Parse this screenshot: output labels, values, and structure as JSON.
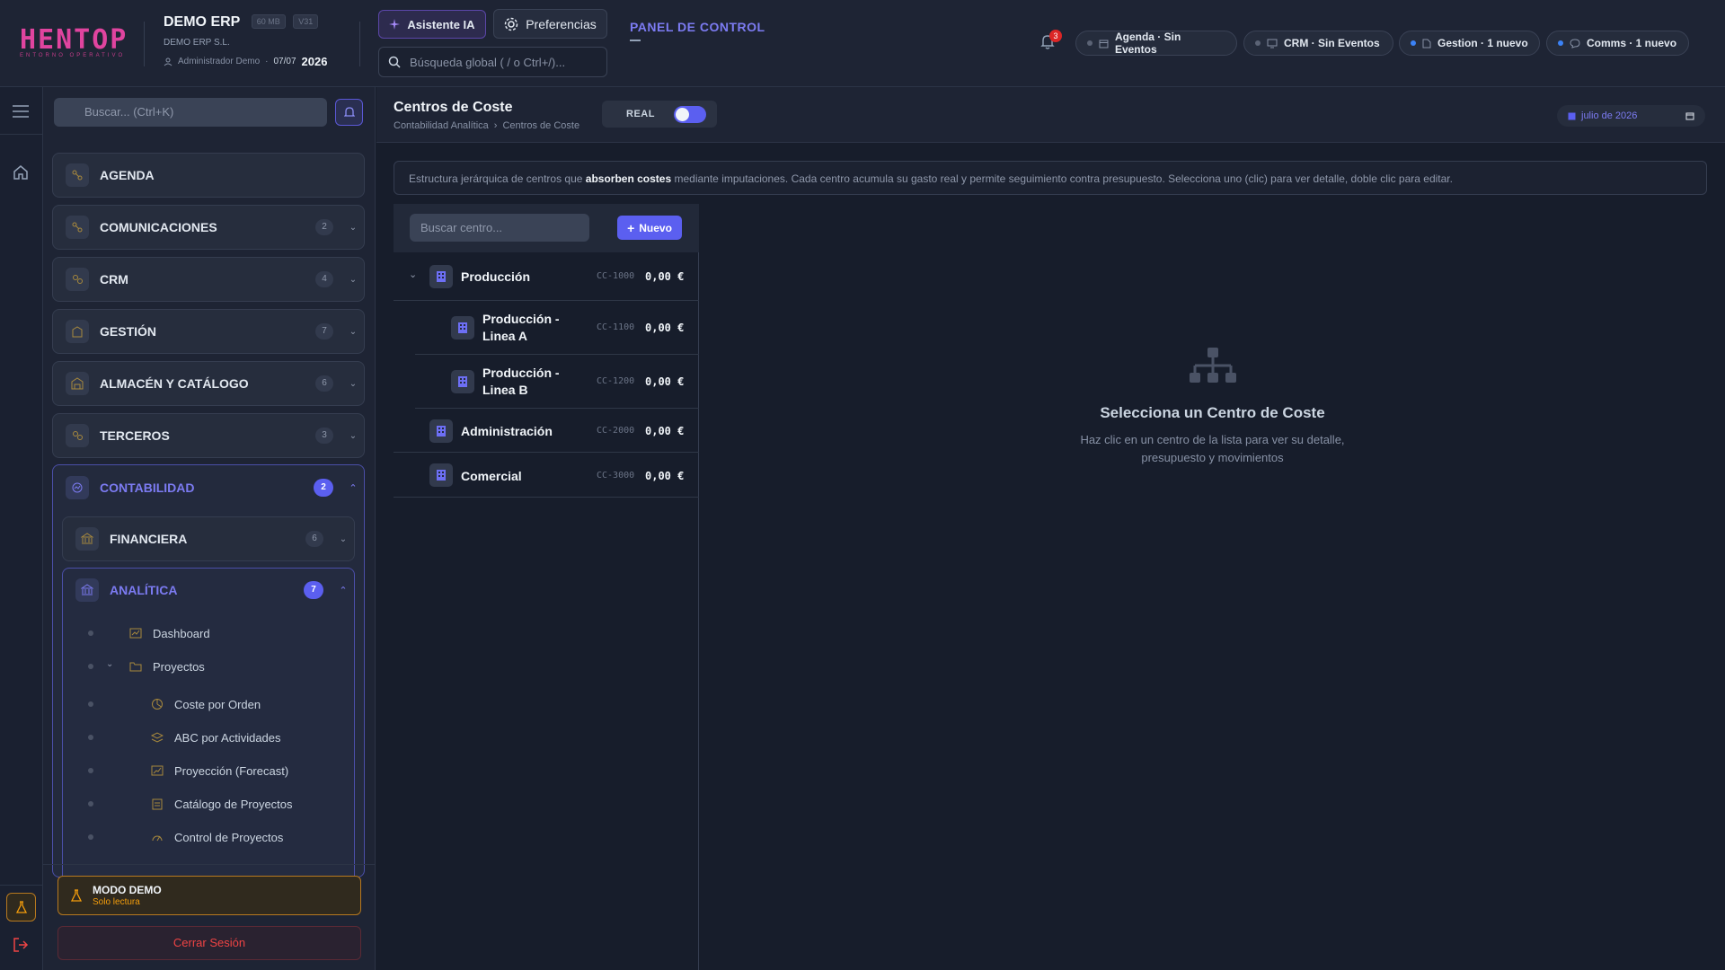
{
  "header": {
    "logo_text": "HENTOP",
    "logo_sub": "ENTORNO OPERATIVO",
    "company_name": "DEMO ERP",
    "badge_size": "60 MB",
    "badge_version": "V31",
    "company_sub": "DEMO ERP S.L.",
    "user": "Administrador Demo",
    "date": "07/07",
    "year": "2026",
    "ai_button": "Asistente IA",
    "prefs_button": "Preferencias",
    "search_placeholder": "Búsqueda global ( / o Ctrl+/)...",
    "panel_title": "PANEL DE CONTROL",
    "notif_count": "3",
    "chips": [
      {
        "label": "Agenda · Sin Eventos",
        "icon": "calendar-icon",
        "status": "inactive"
      },
      {
        "label": "CRM · Sin Eventos",
        "icon": "monitor-icon",
        "status": "inactive"
      },
      {
        "label": "Gestion · 1 nuevo",
        "icon": "document-icon",
        "status": "active"
      },
      {
        "label": "Comms · 1 nuevo",
        "icon": "chat-icon",
        "status": "active"
      }
    ]
  },
  "sidebar": {
    "search_placeholder": "Buscar... (Ctrl+K)",
    "items": [
      {
        "label": "AGENDA",
        "count": null
      },
      {
        "label": "COMUNICACIONES",
        "count": "2"
      },
      {
        "label": "CRM",
        "count": "4"
      },
      {
        "label": "GESTIÓN",
        "count": "7"
      },
      {
        "label": "ALMACÉN Y CATÁLOGO",
        "count": "6"
      },
      {
        "label": "TERCEROS",
        "count": "3"
      }
    ],
    "open_group": {
      "label": "CONTABILIDAD",
      "count": "2"
    },
    "financiera": {
      "label": "FINANCIERA",
      "count": "6"
    },
    "analitica": {
      "label": "ANALÍTICA",
      "count": "7"
    },
    "leaves": [
      "Dashboard",
      "Proyectos",
      "Coste por Orden",
      "ABC por Actividades",
      "Proyección (Forecast)",
      "Catálogo de Proyectos",
      "Control de Proyectos"
    ],
    "demo_title": "MODO DEMO",
    "demo_sub": "Solo lectura",
    "logout": "Cerrar Sesión"
  },
  "main": {
    "title": "Centros de Coste",
    "breadcrumb": [
      "Contabilidad Analítica",
      "Centros de Coste"
    ],
    "toggle_label": "REAL",
    "date": "julio de 2026",
    "info_pre": "Estructura jerárquica de centros que ",
    "info_bold": "absorben costes",
    "info_post": " mediante imputaciones. Cada centro acumula su gasto real y permite seguimiento contra presupuesto. Selecciona uno (clic) para ver detalle, doble clic para editar.",
    "tree_search_placeholder": "Buscar centro...",
    "new_button": "Nuevo",
    "nodes": [
      {
        "label": "Producción",
        "code": "CC-1000",
        "amount": "0,00 €"
      },
      {
        "label": "Producción - Linea A",
        "code": "CC-1100",
        "amount": "0,00 €"
      },
      {
        "label": "Producción - Linea B",
        "code": "CC-1200",
        "amount": "0,00 €"
      },
      {
        "label": "Administración",
        "code": "CC-2000",
        "amount": "0,00 €"
      },
      {
        "label": "Comercial",
        "code": "CC-3000",
        "amount": "0,00 €"
      }
    ],
    "empty_title": "Selecciona un Centro de Coste",
    "empty_sub_1": "Haz clic en un centro de la lista para ver su detalle,",
    "empty_sub_2": "presupuesto y movimientos"
  },
  "colors": {
    "accent": "#5b5ff0",
    "brand": "#e0449f",
    "danger": "#ef4444",
    "warning": "#f59e0b"
  }
}
